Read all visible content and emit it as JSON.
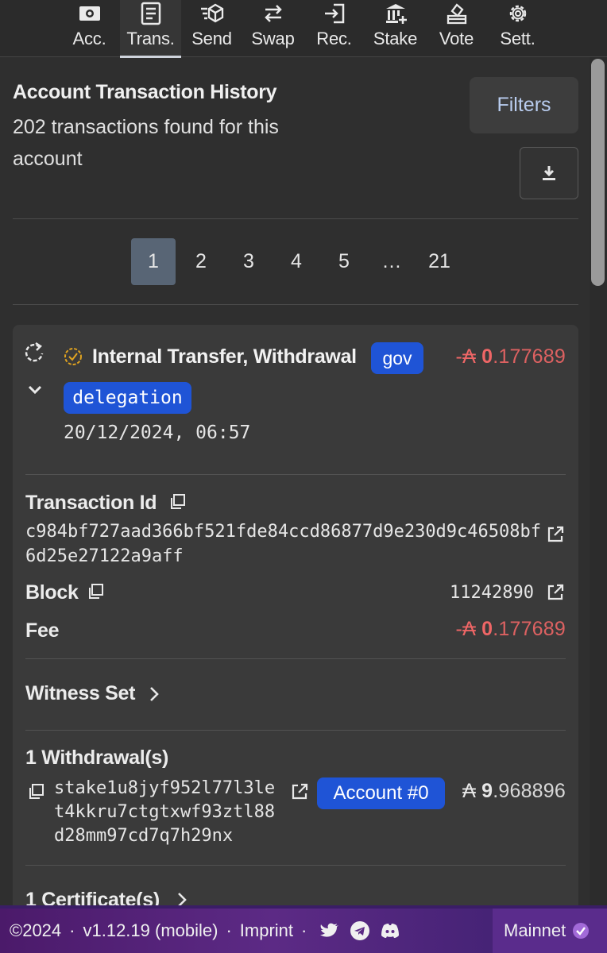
{
  "nav": {
    "items": [
      {
        "label": "Acc.",
        "icon": "wallet-icon"
      },
      {
        "label": "Trans.",
        "icon": "document-icon"
      },
      {
        "label": "Send",
        "icon": "send-icon"
      },
      {
        "label": "Swap",
        "icon": "swap-icon"
      },
      {
        "label": "Rec.",
        "icon": "receive-icon"
      },
      {
        "label": "Stake",
        "icon": "stake-icon"
      },
      {
        "label": "Vote",
        "icon": "vote-icon"
      },
      {
        "label": "Sett.",
        "icon": "gear-icon"
      }
    ],
    "active": "Trans."
  },
  "history": {
    "title": "Account Transaction History",
    "subtitle": "202 transactions found for this account",
    "filters_label": "Filters",
    "download_icon": "download-icon"
  },
  "pagination": {
    "pages": [
      "1",
      "2",
      "3",
      "4",
      "5",
      "…",
      "21"
    ],
    "current": "1"
  },
  "transaction": {
    "type": "Internal Transfer, Withdrawal",
    "tags": [
      "gov",
      "delegation"
    ],
    "amount_sign": "-",
    "currency_symbol": "₳",
    "amount_int": "0",
    "amount_frac": ".177689",
    "date": "20/12/2024, 06:57",
    "details": {
      "tx_id_label": "Transaction Id",
      "tx_id": "c984bf727aad366bf521fde84ccd86877d9e230d9c46508bf6d25e27122a9aff",
      "block_label": "Block",
      "block": "11242890",
      "fee_label": "Fee",
      "fee_sign": "-",
      "fee_int": "0",
      "fee_frac": ".177689"
    },
    "witness_label": "Witness Set",
    "withdrawals": {
      "title": "1 Withdrawal(s)",
      "address": "stake1u8jyf952l77l3let4kkru7ctgtxwf93ztl88d28mm97cd7q7h29nx",
      "account_badge": "Account #0",
      "amount_int": "9",
      "amount_frac": ".968896"
    },
    "certificates_label": "1 Certificate(s)"
  },
  "footer": {
    "copyright": "©2024",
    "version": "v1.12.19 (mobile)",
    "imprint": "Imprint",
    "network": "Mainnet"
  },
  "colors": {
    "negative": "#ef6666",
    "badge": "#1f54d6",
    "page_active": "#586575",
    "footer": "#5c2a85"
  }
}
